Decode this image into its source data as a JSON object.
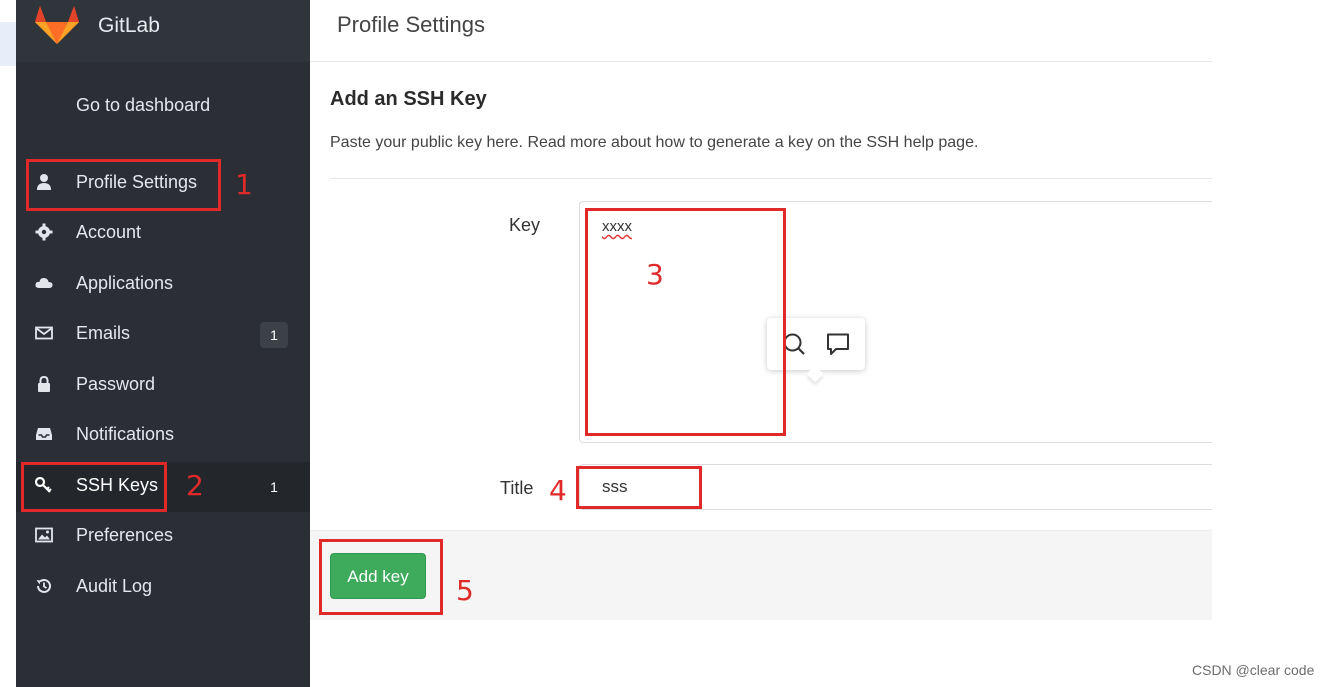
{
  "app": {
    "name": "GitLab"
  },
  "sidebar": {
    "dashboard_link": "Go to dashboard",
    "items": [
      {
        "label": "Profile Settings",
        "icon": "user-icon"
      },
      {
        "label": "Account",
        "icon": "gear-icon"
      },
      {
        "label": "Applications",
        "icon": "cloud-icon"
      },
      {
        "label": "Emails",
        "icon": "envelope-icon",
        "badge": "1"
      },
      {
        "label": "Password",
        "icon": "lock-icon"
      },
      {
        "label": "Notifications",
        "icon": "inbox-icon"
      },
      {
        "label": "SSH Keys",
        "icon": "key-icon",
        "badge": "1",
        "active": true
      },
      {
        "label": "Preferences",
        "icon": "image-icon"
      },
      {
        "label": "Audit Log",
        "icon": "history-icon"
      }
    ]
  },
  "header": {
    "title": "Profile Settings"
  },
  "form": {
    "heading": "Add an SSH Key",
    "description": "Paste your public key here. Read more about how to generate a key on the SSH help page.",
    "key_label": "Key",
    "key_value": "xxxx",
    "title_label": "Title",
    "title_value": "sss",
    "submit_label": "Add key"
  },
  "annotations": {
    "step1": "1",
    "step2": "2",
    "step3": "3",
    "step4": "4",
    "step5": "5",
    "color": "#e02a2a"
  },
  "floating_toolbar": {
    "icons": [
      "search-icon",
      "comment-icon"
    ]
  },
  "watermark": "CSDN @clear code",
  "colors": {
    "sidebar": "#2b2f35",
    "primary_button": "#3dab5b",
    "annotation": "#e02a2a"
  }
}
